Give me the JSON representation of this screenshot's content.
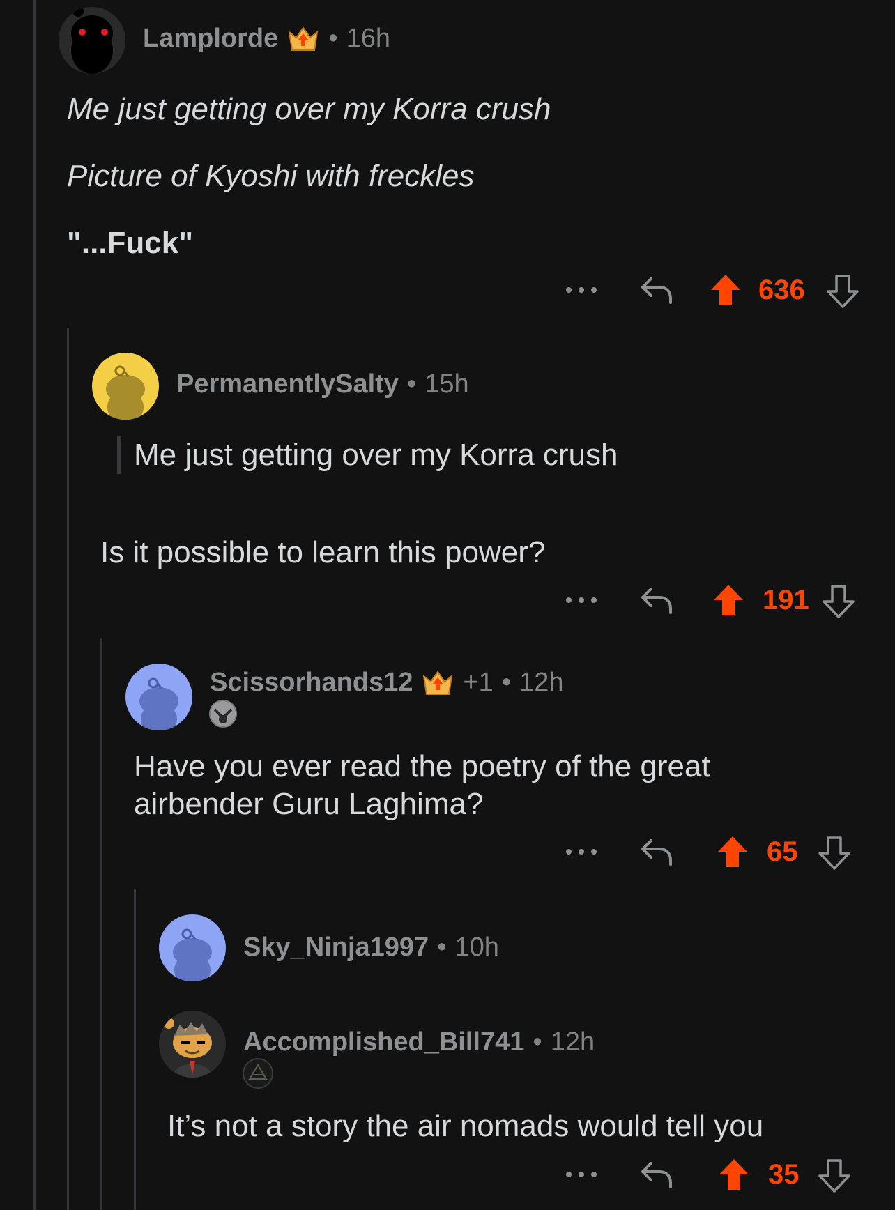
{
  "colors": {
    "background": "#121212",
    "upvote": "#ff4500",
    "muted": "#818384",
    "text": "#d7dadc"
  },
  "comments": [
    {
      "author": "Lamplorde",
      "has_award": true,
      "time": "16h",
      "lines": [
        "Me just getting over my Korra crush",
        "Picture of Kyoshi with freckles",
        "\"...Fuck\""
      ],
      "score": "636"
    },
    {
      "author": "PermanentlySalty",
      "time": "15h",
      "quote": "Me just getting over my Korra crush",
      "body": "Is it possible to learn this power?",
      "score": "191"
    },
    {
      "author": "Scissorhands12",
      "has_award": true,
      "award_extra": "+1",
      "time": "12h",
      "body_lines": [
        "Have you ever read the poetry of the great",
        "airbender Guru Laghima?"
      ],
      "score": "65"
    },
    {
      "author": "Sky_Ninja1997",
      "time": "10h"
    },
    {
      "author": "Accomplished_Bill741",
      "time": "12h",
      "body": "It’s not a story the air nomads would tell you",
      "score": "35"
    }
  ],
  "icons": [
    "more-icon",
    "reply-icon",
    "upvote-icon",
    "downvote-icon",
    "award-icon",
    "avatar-icon",
    "flair-icon"
  ]
}
